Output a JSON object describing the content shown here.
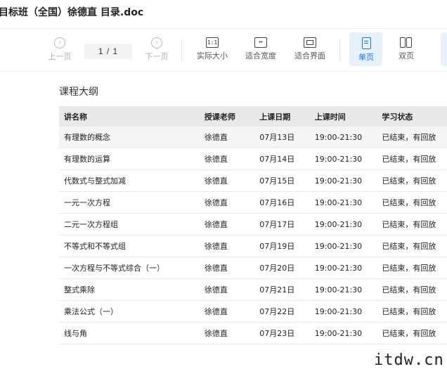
{
  "window": {
    "title": "目标班（全国）徐德直 目录.doc"
  },
  "toolbar": {
    "prev_label": "上一页",
    "page_indicator": "1 / 1",
    "next_label": "下一页",
    "actual_size_label": "实际大小",
    "actual_size_icon_text": "1:1",
    "fit_width_label": "适合宽度",
    "fit_page_label": "适合界面",
    "single_page_label": "单页",
    "double_page_label": "双页",
    "accent_color": "#e6f1fc",
    "icon_color": "#1a73e8"
  },
  "content": {
    "section_title": "课程大纲",
    "columns": [
      "讲名称",
      "授课老师",
      "上课日期",
      "上课时间",
      "学习状态"
    ],
    "rows": [
      [
        "有理数的概念",
        "徐德直",
        "07月13日",
        "19:00-21:30",
        "已结束，有回放"
      ],
      [
        "有理数的运算",
        "徐德直",
        "07月14日",
        "19:00-21:30",
        "已结束，有回放"
      ],
      [
        "代数式与整式加减",
        "徐德直",
        "07月15日",
        "19:00-21:30",
        "已结束，有回放"
      ],
      [
        "一元一次方程",
        "徐德直",
        "07月16日",
        "19:00-21:30",
        "已结束，有回放"
      ],
      [
        "二元一次方程组",
        "徐德直",
        "07月17日",
        "19:00-21:30",
        "已结束，有回放"
      ],
      [
        "不等式和不等式组",
        "徐德直",
        "07月19日",
        "19:00-21:30",
        "已结束，有回放"
      ],
      [
        "一次方程与不等式综合（一）",
        "徐德直",
        "07月20日",
        "19:00-21:30",
        "已结束，有回放"
      ],
      [
        "整式乘除",
        "徐德直",
        "07月21日",
        "19:00-21:30",
        "已结束，有回放"
      ],
      [
        "乘法公式（一）",
        "徐德直",
        "07月22日",
        "19:00-21:30",
        "已结束，有回放"
      ],
      [
        "线与角",
        "徐德直",
        "07月23日",
        "19:00-21:30",
        "已结束，有回放"
      ]
    ]
  },
  "watermark": {
    "text": "itdw.cn"
  }
}
